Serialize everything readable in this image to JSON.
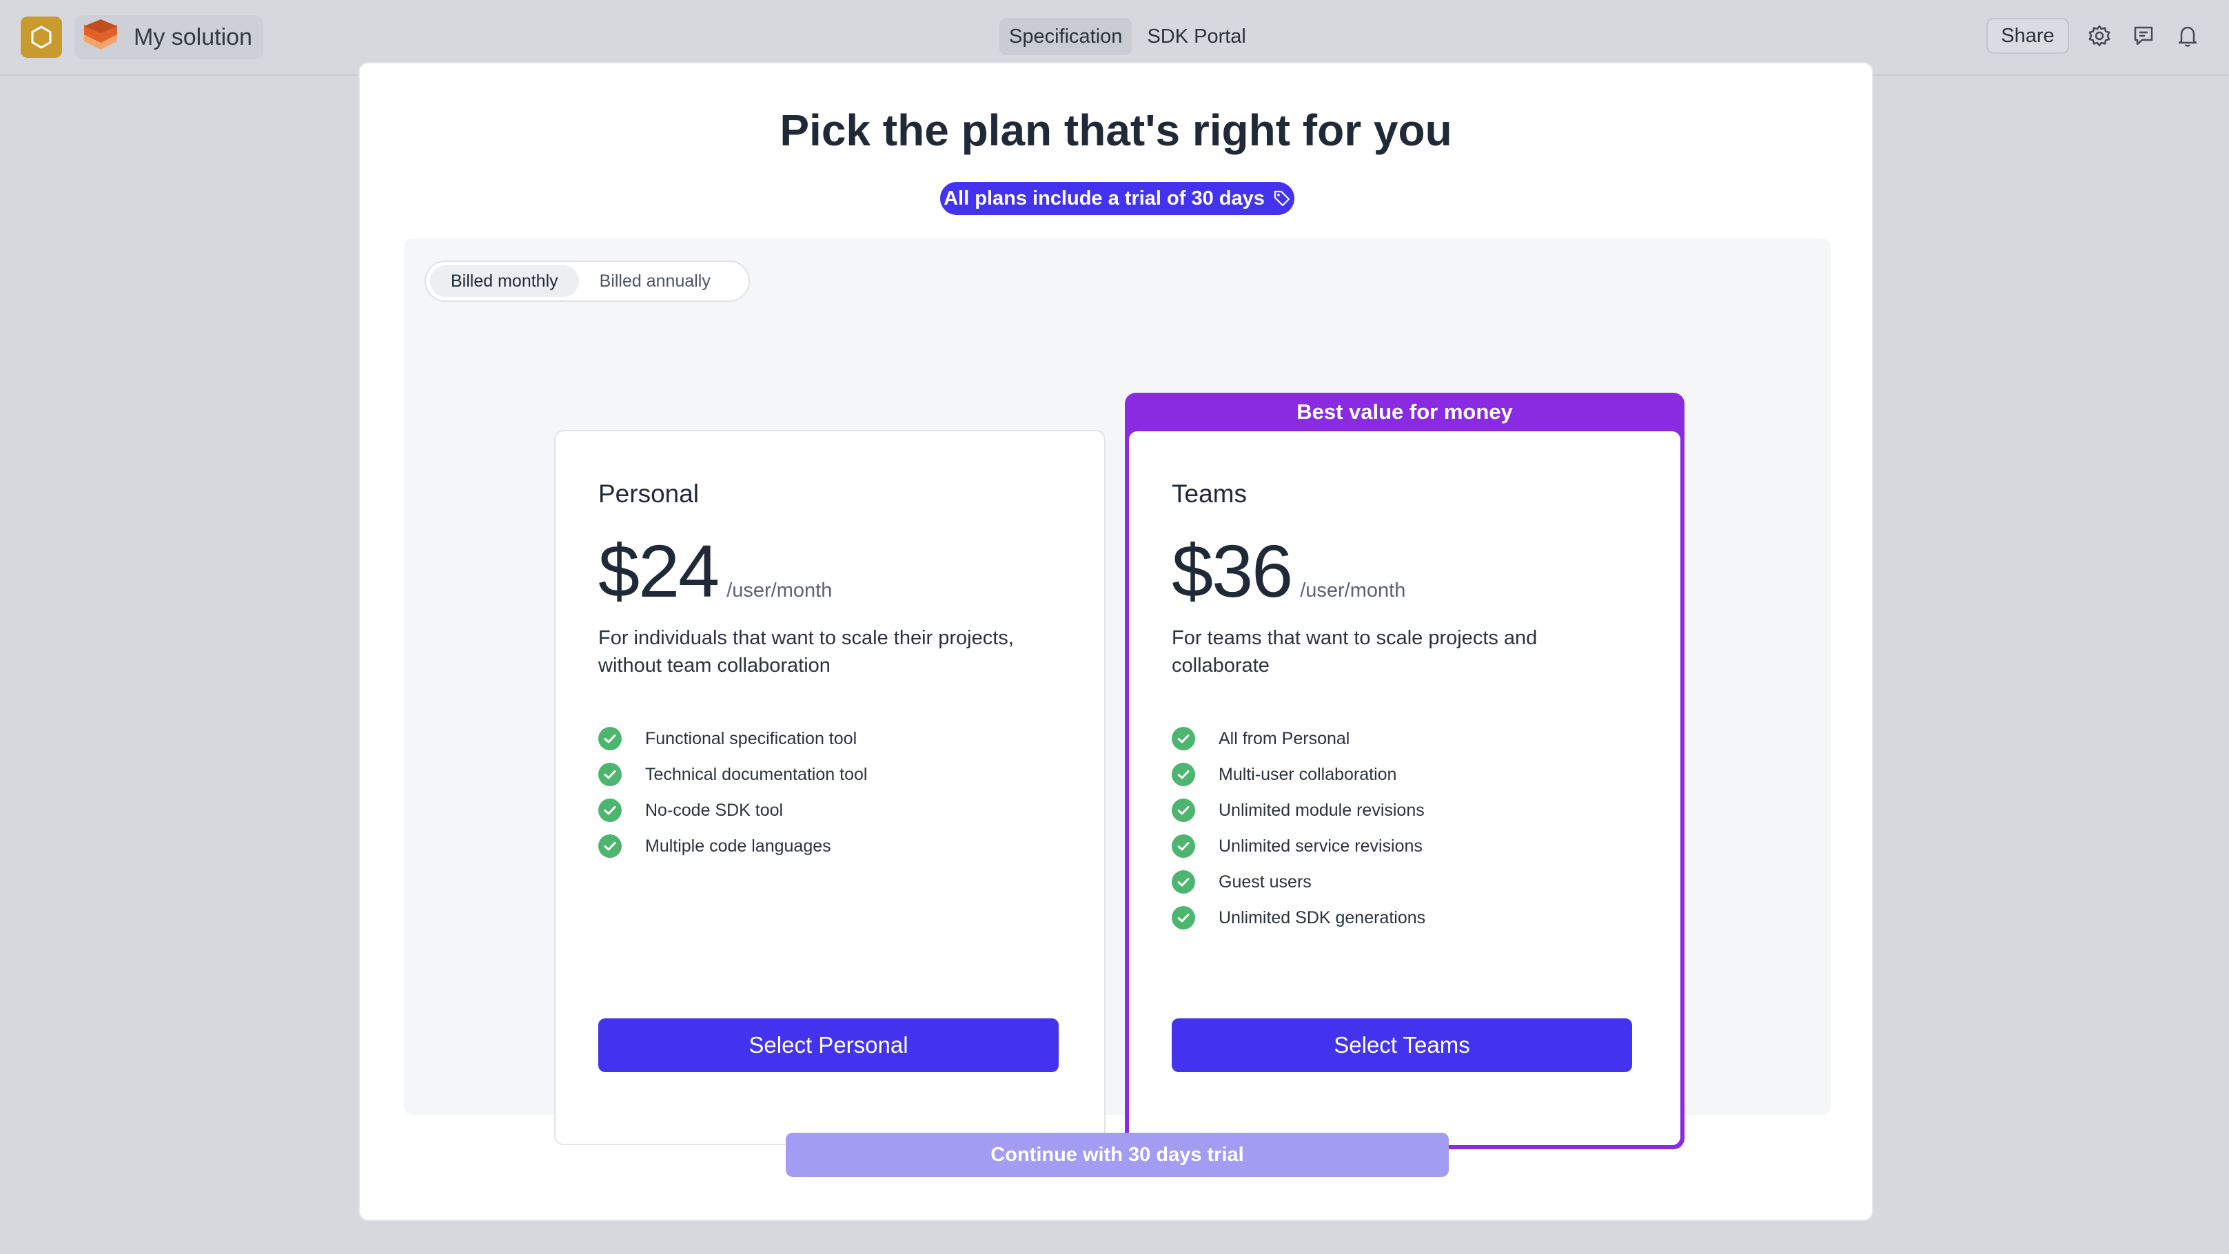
{
  "topbar": {
    "project_name": "My solution",
    "tabs": [
      {
        "label": "Specification",
        "active": true
      },
      {
        "label": "SDK Portal",
        "active": false
      }
    ],
    "share_label": "Share",
    "icons": [
      "gear-icon",
      "comment-icon",
      "bell-icon"
    ]
  },
  "modal": {
    "title": "Pick the plan that's right for you",
    "trial_badge": "All plans include a trial of 30 days",
    "billing": {
      "options": [
        "Billed monthly",
        "Billed annually"
      ],
      "selected": "Billed monthly"
    },
    "plans": [
      {
        "name": "Personal",
        "price": "$24",
        "period": "/user/month",
        "description": "For individuals that want to scale their projects, without team collaboration",
        "features": [
          "Functional specification tool",
          "Technical documentation tool",
          "No-code SDK tool",
          "Multiple code languages"
        ],
        "button": "Select Personal"
      },
      {
        "name": "Teams",
        "banner": "Best value for money",
        "price": "$36",
        "period": "/user/month",
        "description": "For teams that want to scale projects and collaborate",
        "features": [
          "All from Personal",
          "Multi-user collaboration",
          "Unlimited module revisions",
          "Unlimited service revisions",
          "Guest users",
          "Unlimited SDK generations"
        ],
        "button": "Select Teams"
      }
    ],
    "continue_label": "Continue with 30 days trial"
  },
  "colors": {
    "accent": "#4433ee",
    "highlight": "#8a2be2",
    "check": "#4cb56e",
    "background": "#d6d8dd"
  }
}
